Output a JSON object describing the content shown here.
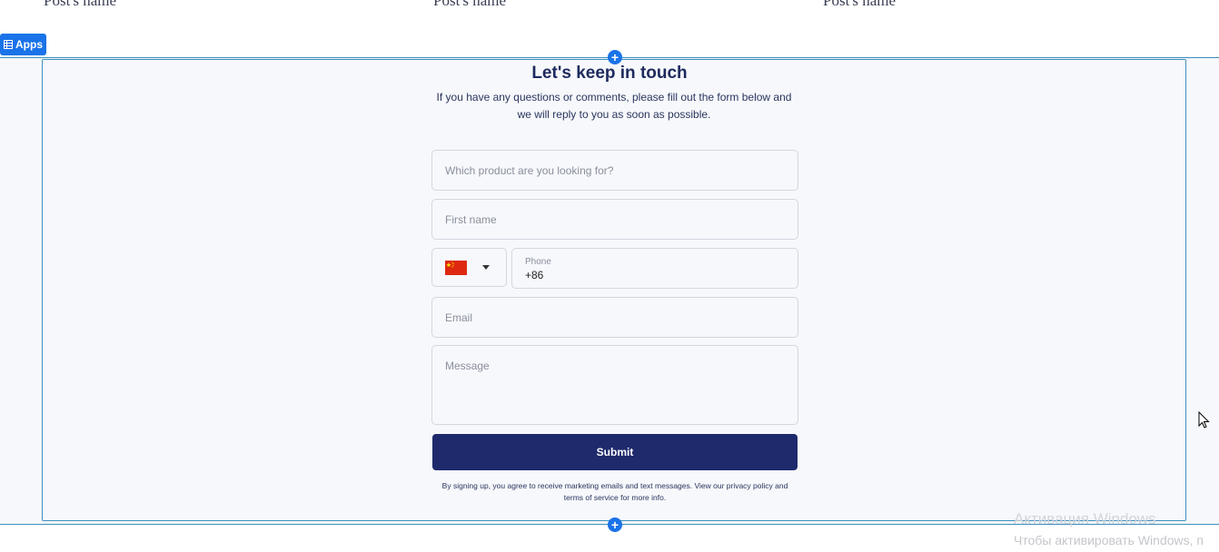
{
  "posts": {
    "names": [
      "Post's name",
      "Post's name",
      "Post's name"
    ]
  },
  "editor": {
    "apps_label": "Apps",
    "apps_icon": "grid-list-icon",
    "add_icon": "+",
    "accent_color": "#1a73e8"
  },
  "contact": {
    "title": "Let's keep in touch",
    "subtitle": "If you have any questions or comments, please fill out the form below and we will reply to you as soon as possible.",
    "product_placeholder": "Which product are you looking for?",
    "first_name_placeholder": "First name",
    "country_flag": "china-flag-icon",
    "phone_label": "Phone",
    "phone_value": "+86",
    "email_placeholder": "Email",
    "message_placeholder": "Message",
    "submit_label": "Submit",
    "submit_color": "#1e2a6b",
    "terms": "By signing up, you agree to receive marketing emails and text messages. View our privacy policy and terms of service for more info."
  },
  "windows": {
    "activation_title": "Активация Windows",
    "activation_sub": "Чтобы активировать Windows, п"
  }
}
